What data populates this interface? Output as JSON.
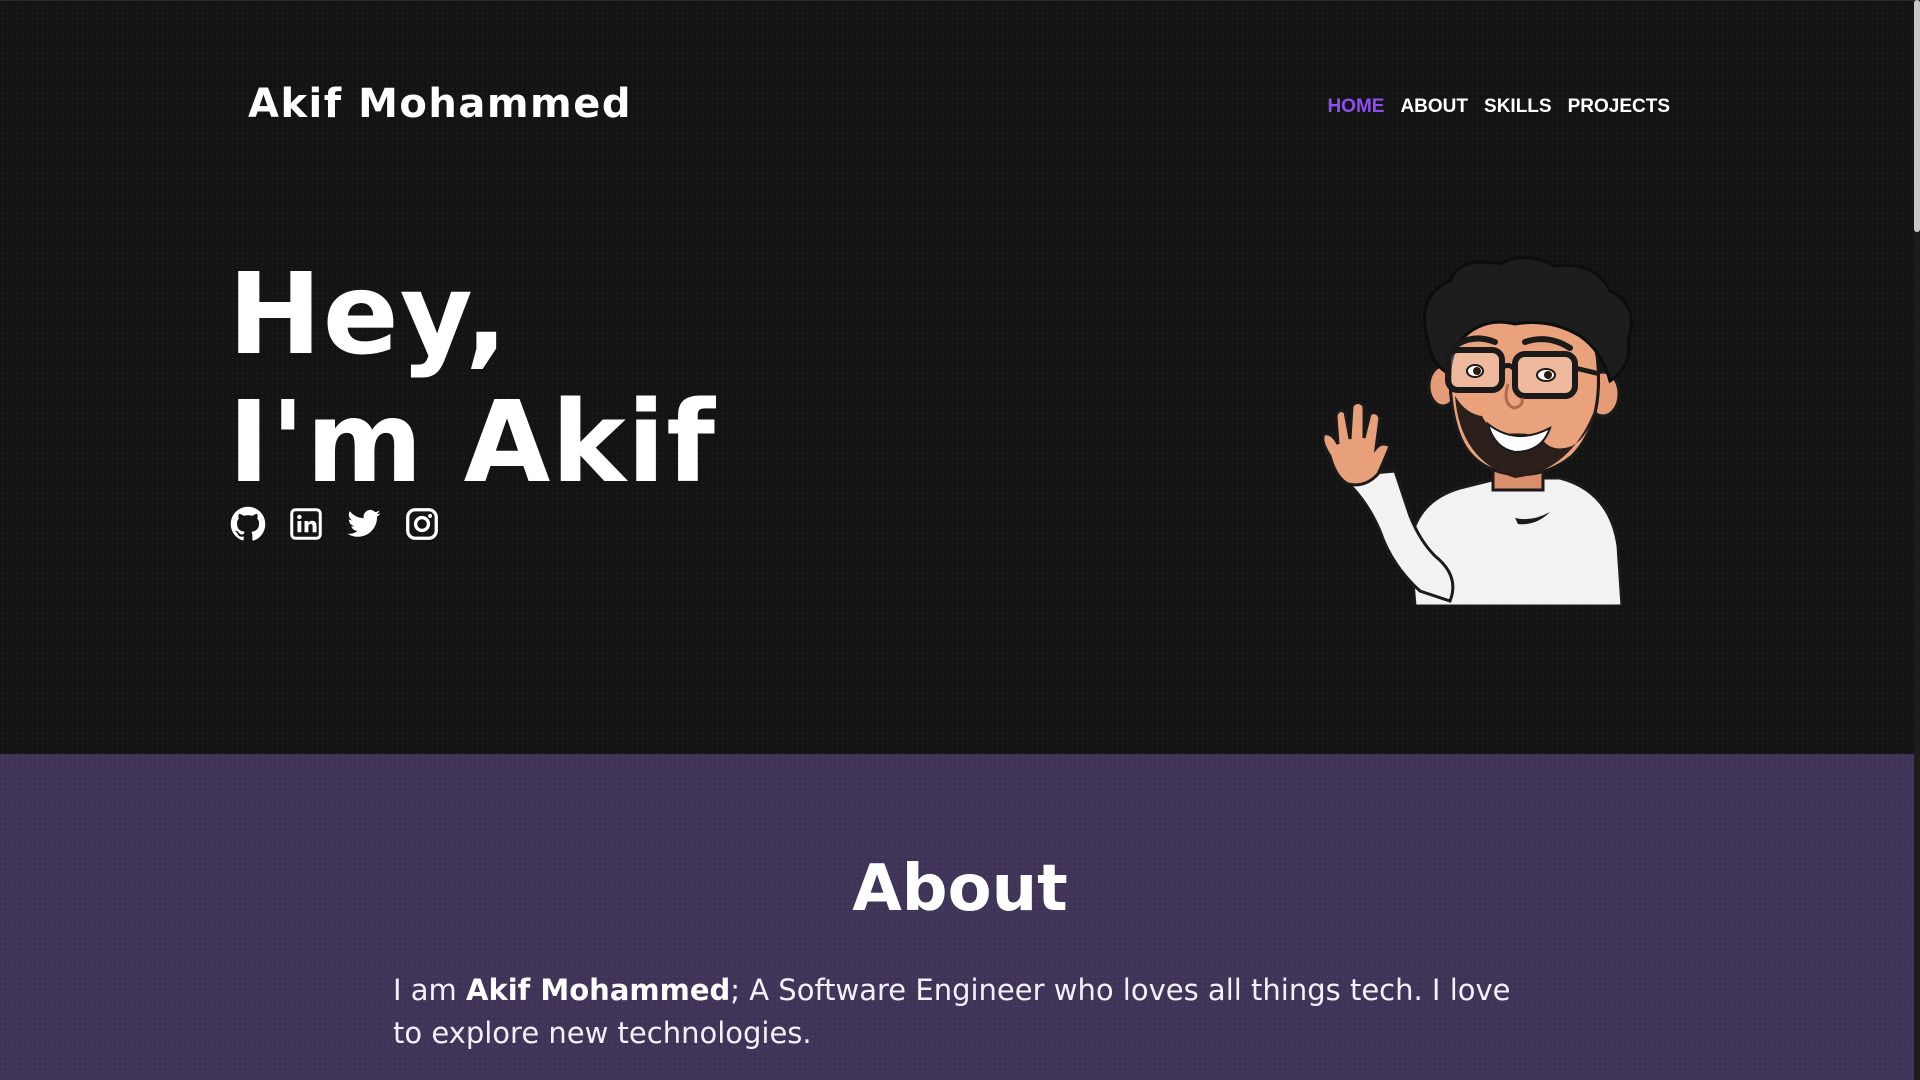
{
  "header": {
    "brand": "Akif Mohammed",
    "nav": [
      {
        "label": "HOME",
        "active": true
      },
      {
        "label": "ABOUT",
        "active": false
      },
      {
        "label": "SKILLS",
        "active": false
      },
      {
        "label": "PROJECTS",
        "active": false
      }
    ]
  },
  "hero": {
    "line1": "Hey,",
    "line2": "I'm Akif",
    "social_icons": [
      "github-icon",
      "linkedin-icon",
      "twitter-icon",
      "instagram-icon"
    ]
  },
  "about": {
    "heading": "About",
    "text_prefix": "I am ",
    "name": "Akif Mohammed",
    "text_suffix": "; A Software Engineer who loves all things tech. I love to explore new technologies."
  },
  "colors": {
    "accent": "#8d4ff0",
    "hero_bg": "#131313",
    "about_bg": "#3f3357"
  }
}
